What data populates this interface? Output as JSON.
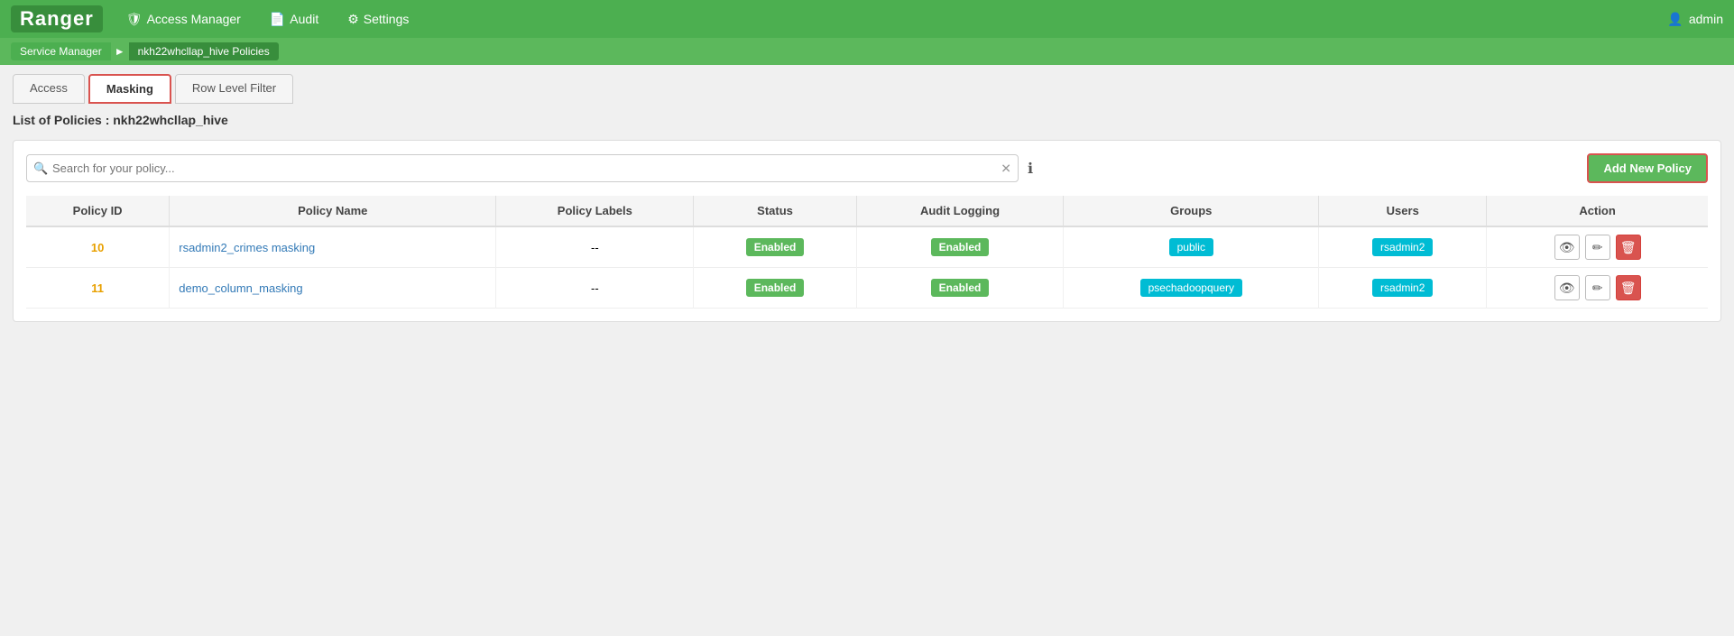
{
  "app": {
    "logo": "Ranger"
  },
  "topnav": {
    "items": [
      {
        "id": "access-manager",
        "icon": "🛡",
        "label": "Access Manager"
      },
      {
        "id": "audit",
        "icon": "📄",
        "label": "Audit"
      },
      {
        "id": "settings",
        "icon": "⚙",
        "label": "Settings"
      }
    ],
    "user": {
      "icon": "👤",
      "name": "admin"
    }
  },
  "breadcrumb": {
    "items": [
      {
        "id": "service-manager",
        "label": "Service Manager"
      },
      {
        "id": "current",
        "label": "nkh22whcllap_hive Policies"
      }
    ]
  },
  "tabs": [
    {
      "id": "access",
      "label": "Access",
      "active": false
    },
    {
      "id": "masking",
      "label": "Masking",
      "active": true
    },
    {
      "id": "row-level-filter",
      "label": "Row Level Filter",
      "active": false
    }
  ],
  "page": {
    "heading": "List of Policies : nkh22whcllap_hive"
  },
  "search": {
    "placeholder": "Search for your policy...",
    "value": ""
  },
  "add_button_label": "Add New Policy",
  "table": {
    "columns": [
      "Policy ID",
      "Policy Name",
      "Policy Labels",
      "Status",
      "Audit Logging",
      "Groups",
      "Users",
      "Action"
    ],
    "rows": [
      {
        "id": "10",
        "name": "rsadmin2_crimes masking",
        "labels": "--",
        "status": "Enabled",
        "audit_logging": "Enabled",
        "groups": "public",
        "users": "rsadmin2"
      },
      {
        "id": "11",
        "name": "demo_column_masking",
        "labels": "--",
        "status": "Enabled",
        "audit_logging": "Enabled",
        "groups": "psechadoopquery",
        "users": "rsadmin2"
      }
    ]
  }
}
